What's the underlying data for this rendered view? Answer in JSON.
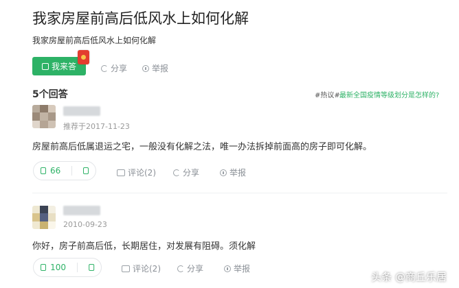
{
  "question": {
    "title": "我家房屋前高后低风水上如何化解",
    "subtitle": "我家房屋前高后低风水上如何化解"
  },
  "actions": {
    "answer_label": "我来答",
    "share_label": "分享",
    "report_label": "举报"
  },
  "answers_header": {
    "count_label": "5个回答",
    "hot_tag": "#热议#",
    "hot_link": "最新全国疫情等级划分是怎样的?"
  },
  "answers": [
    {
      "meta": "推荐于2017-11-23",
      "content": "房屋前高后低属退运之宅，一般没有化解之法，唯一办法拆掉前面高的房子即可化解。",
      "likes": "66",
      "comment_label": "评论(2)",
      "share_label": "分享",
      "report_label": "举报"
    },
    {
      "meta": "2010-09-23",
      "content": "你好，房子前高后低，长期居住，对发展有阻碍。须化解",
      "likes": "100",
      "comment_label": "评论(2)",
      "share_label": "分享",
      "report_label": "举报"
    }
  ],
  "watermark": "头条 @商丘乐居",
  "colors": {
    "accent": "#2db266",
    "muted": "#8a8f96"
  }
}
